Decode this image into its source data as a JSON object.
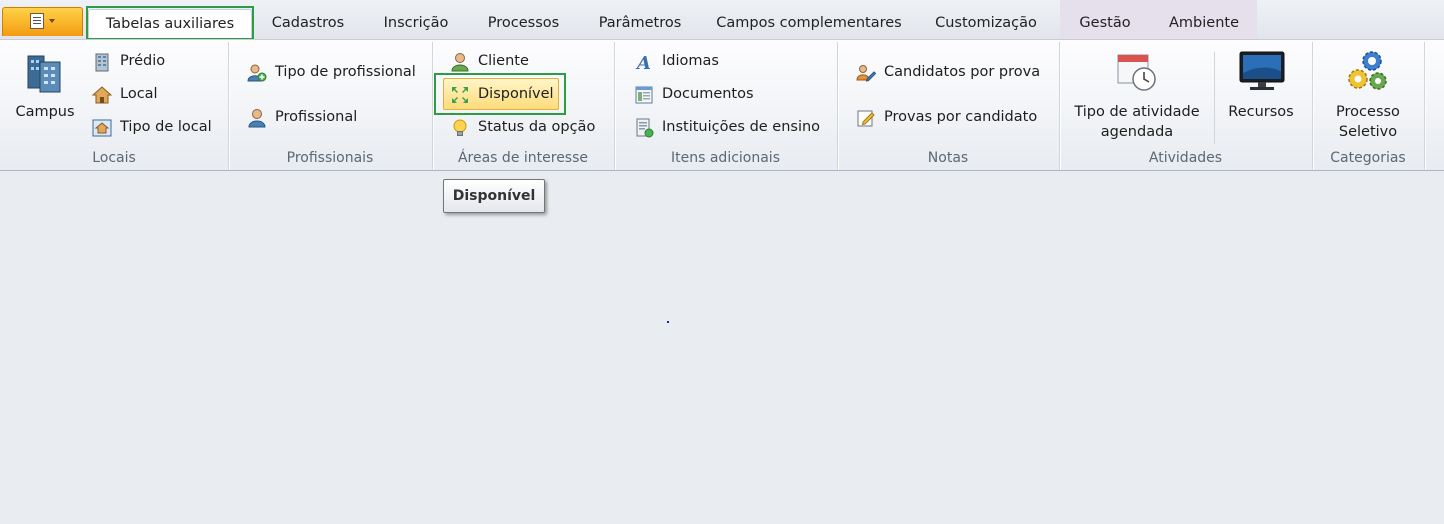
{
  "tabs": [
    {
      "label": "Tabelas auxiliares"
    },
    {
      "label": "Cadastros"
    },
    {
      "label": "Inscrição"
    },
    {
      "label": "Processos"
    },
    {
      "label": "Parâmetros"
    },
    {
      "label": "Campos complementares"
    },
    {
      "label": "Customização"
    },
    {
      "label": "Gestão"
    },
    {
      "label": "Ambiente"
    }
  ],
  "groups": {
    "locais": {
      "label": "Locais",
      "campus": "Campus",
      "items": [
        "Prédio",
        "Local",
        "Tipo de local"
      ]
    },
    "profissionais": {
      "label": "Profissionais",
      "items": [
        "Tipo de profissional",
        "Profissional"
      ]
    },
    "areas": {
      "label": "Áreas de interesse",
      "items": [
        "Cliente",
        "Disponível",
        "Status da opção"
      ]
    },
    "itens": {
      "label": "Itens adicionais",
      "items": [
        "Idiomas",
        "Documentos",
        "Instituições de ensino"
      ]
    },
    "notas": {
      "label": "Notas",
      "items": [
        "Candidatos por prova",
        "Provas por candidato"
      ]
    },
    "atividades": {
      "label": "Atividades",
      "tipo_line1": "Tipo de atividade",
      "tipo_line2": "agendada",
      "recursos": "Recursos"
    },
    "categorias": {
      "label": "Categorias",
      "processo_line1": "Processo",
      "processo_line2": "Seletivo"
    }
  },
  "tooltip": "Disponível",
  "colors": {
    "highlight": "#2e9b47",
    "app_menu": "#f5a623",
    "selected_button": "#fde89a"
  }
}
